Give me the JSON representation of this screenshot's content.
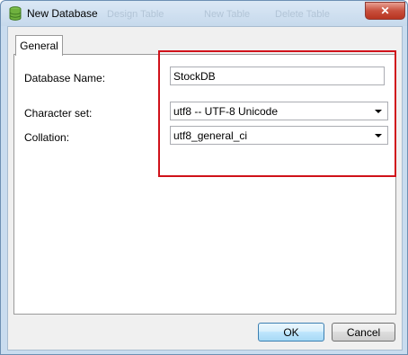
{
  "window": {
    "title": "New Database",
    "ghost_toolbar": [
      "Design Table",
      "New Table",
      "Delete Table"
    ],
    "close_label": "✕"
  },
  "tabs": [
    {
      "label": "General",
      "active": true
    }
  ],
  "form": {
    "database_name": {
      "label": "Database Name:",
      "value": "StockDB"
    },
    "character_set": {
      "label": "Character set:",
      "value": "utf8 -- UTF-8 Unicode"
    },
    "collation": {
      "label": "Collation:",
      "value": "utf8_general_ci"
    }
  },
  "buttons": {
    "ok": "OK",
    "cancel": "Cancel"
  },
  "colors": {
    "highlight": "#d0121a",
    "title_bar": "#c9dcef",
    "close_button": "#c8503d"
  },
  "icons": {
    "title": "database-icon",
    "dropdown": "chevron-down-icon"
  }
}
